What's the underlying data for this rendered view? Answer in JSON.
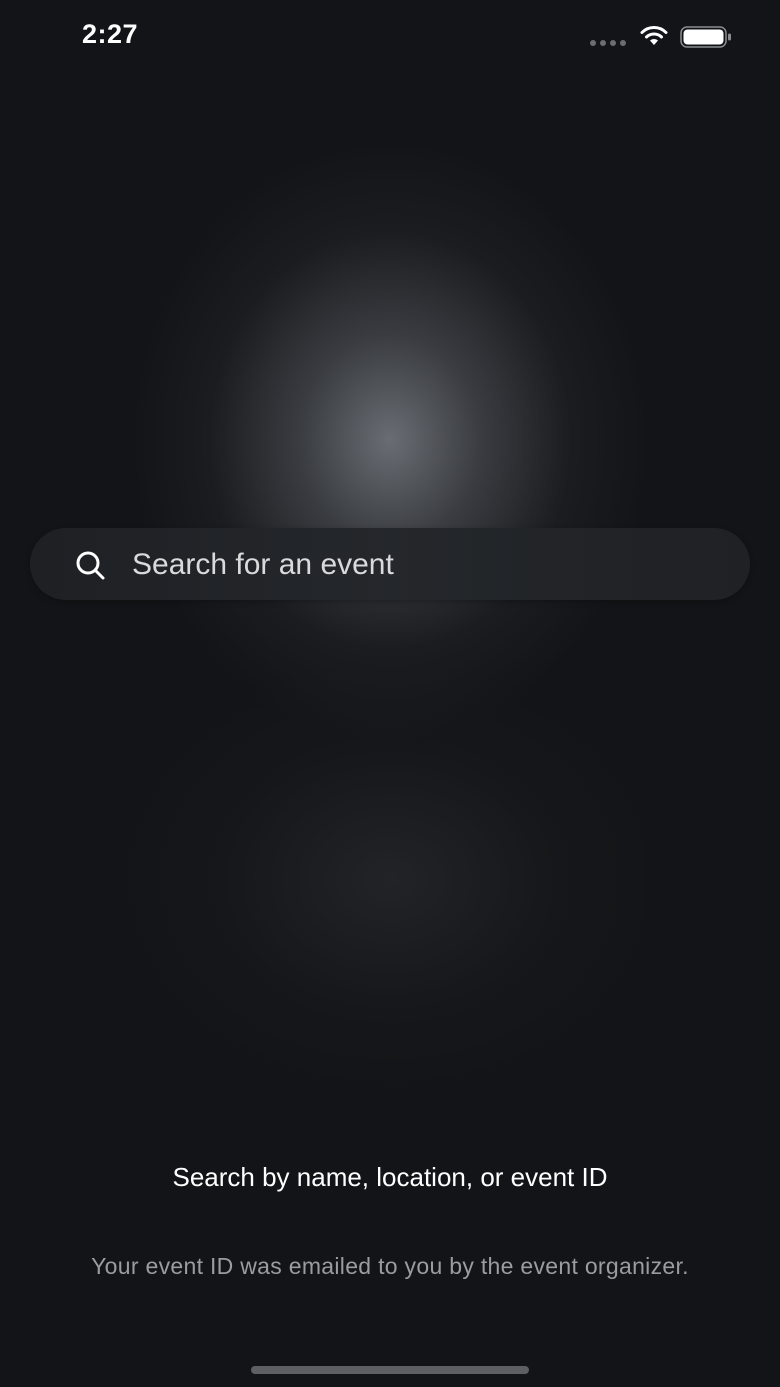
{
  "status_bar": {
    "time": "2:27"
  },
  "search": {
    "placeholder": "Search for an event",
    "value": "",
    "icon": "search-icon"
  },
  "hint": {
    "title": "Search by name, location, or event ID",
    "subtitle": "Your event ID was emailed to you by the event organizer."
  },
  "colors": {
    "background": "#121417",
    "search_bar": "#222428",
    "text_primary": "#ffffff",
    "text_secondary": "#9a9c9f"
  }
}
